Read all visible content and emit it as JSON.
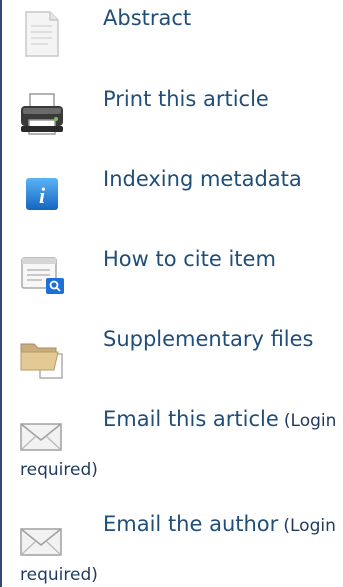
{
  "reading_tools": {
    "items": [
      {
        "label": "Abstract",
        "icon": "document-icon"
      },
      {
        "label": "Print this article",
        "icon": "printer-icon"
      },
      {
        "label": "Indexing metadata",
        "icon": "info-icon"
      },
      {
        "label": "How to cite item",
        "icon": "cite-icon"
      },
      {
        "label": "Supplementary files",
        "icon": "folder-icon"
      },
      {
        "label": "Email this article",
        "note_open": "(Login",
        "note_close": "required)",
        "icon": "envelope-icon"
      },
      {
        "label": "Email the author",
        "note_open": "(Login",
        "note_close": "required)",
        "icon": "envelope-icon"
      }
    ]
  },
  "colors": {
    "link": "#1f4e79",
    "text": "#1f3a5f",
    "border": "#2f4b73",
    "info_blue": "#1e88e5"
  }
}
